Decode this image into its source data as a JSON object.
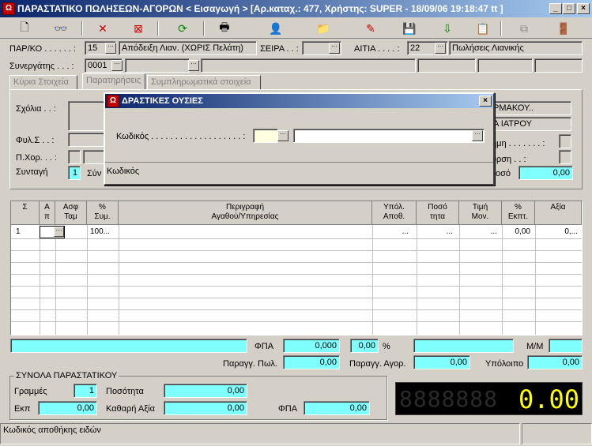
{
  "window": {
    "title": "ΠΑΡΑΣΤΑΤΙΚΟ ΠΩΛΗΣΕΩΝ-ΑΓΟΡΩΝ < Εισαγωγή > [Αρ.καταχ.: 477, Χρήστης: SUPER - 18/09/06 19:18:47 tt ]",
    "min": "_",
    "max": "□",
    "close": "×"
  },
  "toolbar": {
    "new": "🗋",
    "binoculars": "👓",
    "delete": "✕",
    "cancel": "⊠",
    "refresh": "⟳",
    "print": "🖶",
    "person": "👤",
    "folder": "📁",
    "pen": "✎",
    "disk": "💾",
    "arrow": "⇩",
    "paste": "📋",
    "copy": "⧉",
    "exit": "🚪"
  },
  "header": {
    "parko_label": "ΠΑΡ/ΚΟ . . . . . . :",
    "parko_code": "15",
    "parko_desc": "Απόδειξη Λιαν. (ΧΩΡΙΣ Πελάτη)",
    "seira_label": "ΣΕΙΡΑ . . :",
    "seira_value": "",
    "aitia_label": "ΑΙΤΙΑ . . . . :",
    "aitia_code": "22",
    "aitia_desc": "Πωλήσεις Λιανικής",
    "synergatis_label": "Συνεργάτης . . . :",
    "synergatis_code": "0001"
  },
  "tabs": [
    "Κύρια Στοιχεία",
    "Παρατηρήσεις",
    "Συμπληρωματικά στοιχεία"
  ],
  "form": {
    "sxolia": "Σχόλια . . :",
    "fyl": "Φυλ.Σ . . :",
    "pxor": "Π.Χορ. . . :",
    "syntagi": "Συνταγή",
    "syntagi_val": "1",
    "syn_trunc": "Σύν",
    "farmakou": "ΡΜΑΚΟΥ..",
    "iatrou": "Α ΙΑΤΡΟΥ",
    "imi": "ημη . . . . . . . :",
    "ursi": "υρση . . :",
    "poso": "οσό",
    "poso_val": "0,00"
  },
  "dialog": {
    "title": "ΔΡΑΣΤΙΚΕΣ ΟΥΣΙΕΣ",
    "close": "×",
    "kodikos_label": "Κωδικός . . . . . . . . . . . . . . . . . . . :",
    "status": "Κωδικός"
  },
  "grid": {
    "headers": [
      "Σ",
      "Α\nπ",
      "Ασφ\nΤαμ",
      "%\nΣυμ.",
      "Περιγραφή\nΑγαθού/Υπηρεσίας",
      "Υπόλ.\nΑποθ.",
      "Ποσό\nτητα",
      "Τιμή\nΜον.",
      "%\nΕκπτ.",
      "Αξία"
    ],
    "row": {
      "s": "1",
      "sym": "100...",
      "apoth": "...",
      "posot": "...",
      "timi": "...",
      "ekpt": "0,00",
      "axia": "0,..."
    }
  },
  "totals": {
    "fpa_label": "ΦΠΑ",
    "fpa_val": "0,000",
    "fpa_pct": "0,00",
    "pct": "%",
    "mm_label": "Μ/Μ",
    "parag_pol_label": "Παραγγ. Πωλ.",
    "parag_pol_val": "0,00",
    "parag_agor_label": "Παραγγ. Αγορ.",
    "parag_agor_val": "0,00",
    "ypoloipo_label": "Υπόλοιπο",
    "ypoloipo_val": "0,00"
  },
  "summary": {
    "title": "ΣΥΝΟΛΑ ΠΑΡΑΣΤΑΤΙΚΟΥ",
    "grammes_label": "Γραμμές",
    "grammes_val": "1",
    "posotita_label": "Ποσότητα",
    "posotita_val": "0,00",
    "ekp_label": "Εκπ",
    "ekp_val": "0,00",
    "kathari_label": "Καθαρή Αξία",
    "kathari_val": "0,00",
    "fpa_label": "ΦΠΑ",
    "fpa_val": "0,00",
    "led_val": "0.00"
  },
  "status": {
    "text": "Κωδικός αποθήκης ειδών"
  }
}
